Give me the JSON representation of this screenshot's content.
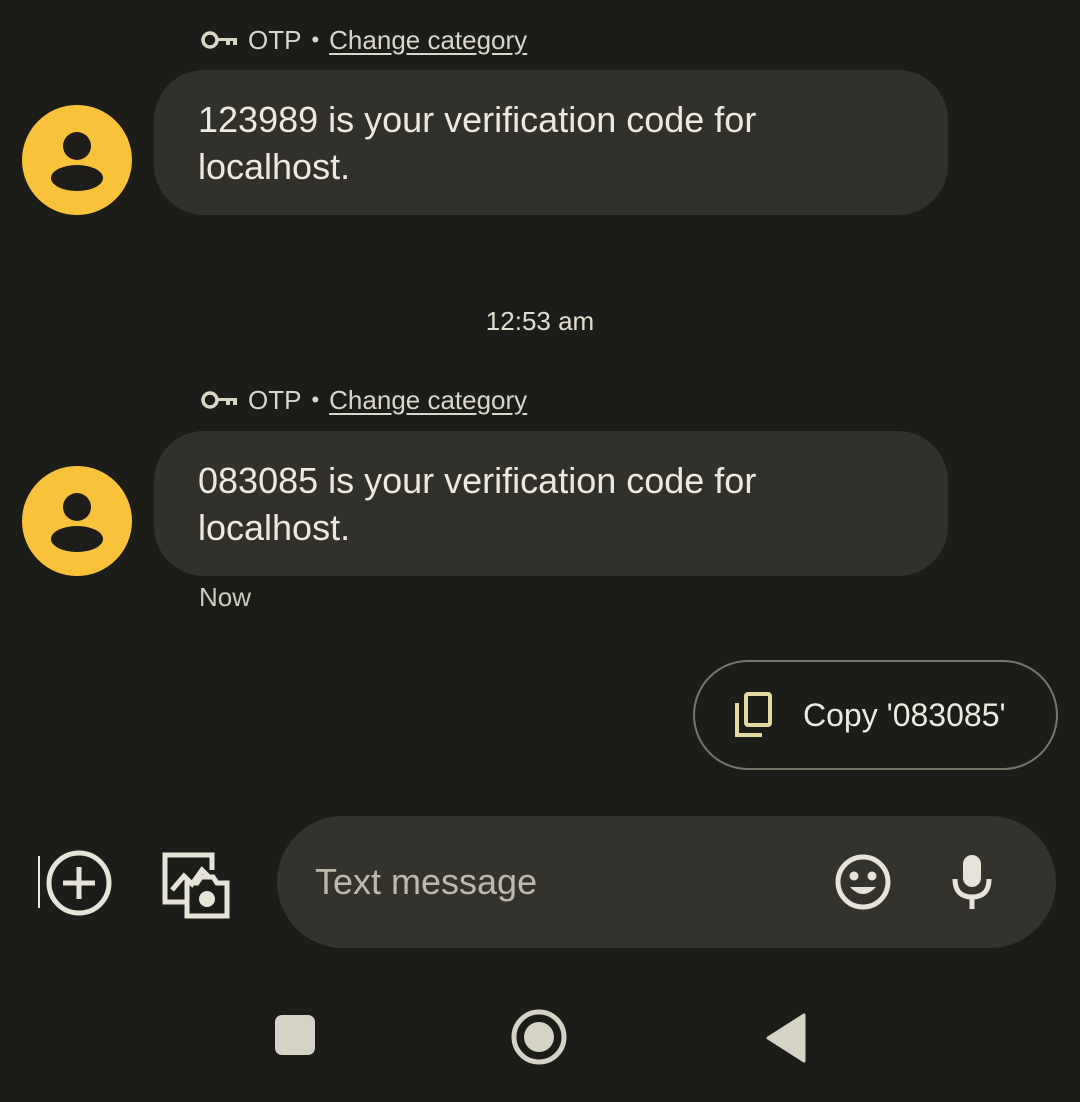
{
  "messages": [
    {
      "category_label": "OTP",
      "category_separator": "•",
      "change_category_label": "Change category",
      "text": "123989 is your verification code for localhost."
    },
    {
      "category_label": "OTP",
      "category_separator": "•",
      "change_category_label": "Change category",
      "text": "083085 is your verification code for localhost."
    }
  ],
  "timestamp_divider": "12:53 am",
  "last_message_time": "Now",
  "suggestion": {
    "copy_label": "Copy '083085'",
    "icon": "copy-icon"
  },
  "composer": {
    "placeholder": "Text message",
    "value": ""
  },
  "icons": {
    "attach": "add-circle-icon",
    "gallery": "gallery-camera-icon",
    "emoji": "emoji-icon",
    "voice": "microphone-icon",
    "category": "key-icon",
    "avatar": "person-icon"
  },
  "nav": {
    "recents": "square-icon",
    "home": "circle-icon",
    "back": "triangle-back-icon"
  },
  "colors": {
    "background": "#1c1c19",
    "bubble": "#31302b",
    "avatar": "#f8c33b",
    "accent_icon": "#e3d9a3"
  }
}
